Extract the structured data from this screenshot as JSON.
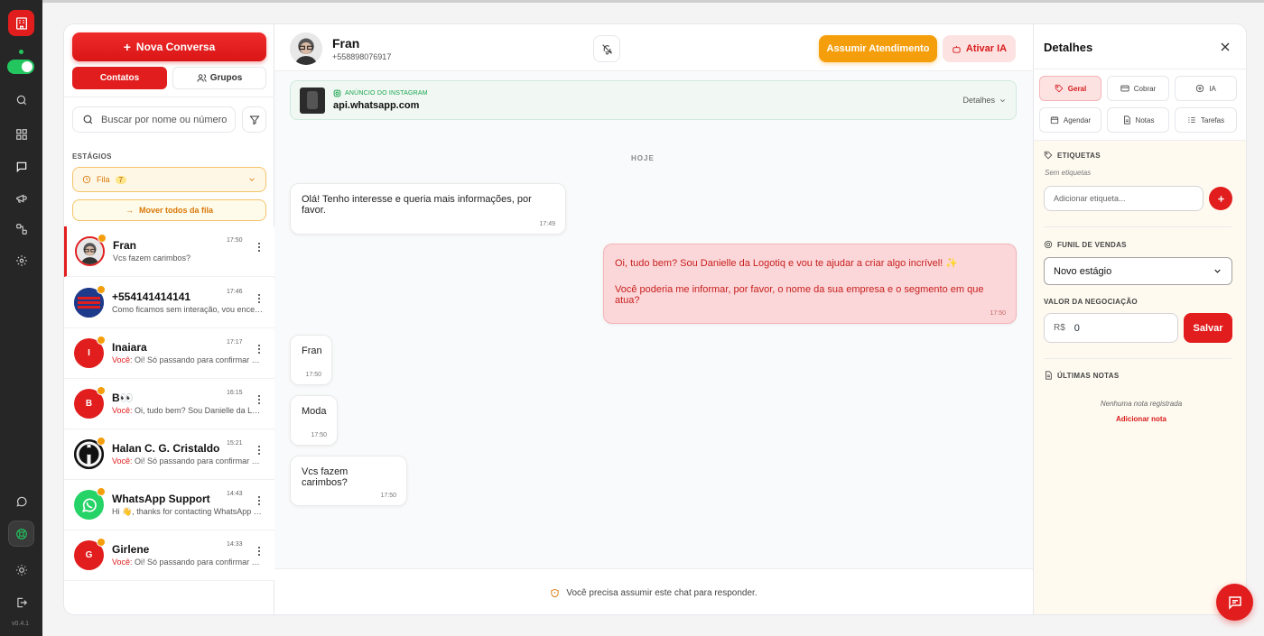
{
  "app": {
    "version": "v0.4.1"
  },
  "sidebar_left": {
    "icons": [
      "building-icon",
      "home-icon",
      "search-icon",
      "dashboard-icon",
      "chat-icon",
      "megaphone-icon",
      "flow-icon",
      "settings-icon",
      "whatsapp-icon",
      "support-icon",
      "sun-icon",
      "logout-icon"
    ]
  },
  "conversations": {
    "new_button": "Nova Conversa",
    "tabs": {
      "contacts": "Contatos",
      "groups": "Grupos"
    },
    "search_placeholder": "Buscar por nome ou número",
    "stages_label": "ESTÁGIOS",
    "stage_selected": "Fila",
    "stage_count": "7",
    "move_all": "Mover todos da fila",
    "you_prefix": "Você:",
    "items": [
      {
        "name": "Fran",
        "time": "17:50",
        "preview": "Vcs fazem carimbos?",
        "you": false,
        "initial": ""
      },
      {
        "name": "+554141414141",
        "time": "17:46",
        "preview": "Como ficamos sem interação, vou encerrar",
        "you": false,
        "initial": ""
      },
      {
        "name": "Inaiara",
        "time": "17:17",
        "preview": "Oi! Só passando para confirmar se ainda",
        "you": true,
        "initial": "I"
      },
      {
        "name": "B👀",
        "time": "16:15",
        "preview": "Oi, tudo bem? Sou Danielle da Logotiq",
        "you": true,
        "initial": "B"
      },
      {
        "name": "Halan C. G. Cristaldo",
        "time": "15:21",
        "preview": "Oi! Só passando para confirmar se ainda",
        "you": true,
        "initial": ""
      },
      {
        "name": "WhatsApp Support",
        "time": "14:43",
        "preview": "Hi 👋, thanks for contacting WhatsApp Support",
        "you": false,
        "initial": ""
      },
      {
        "name": "Girlene",
        "time": "14:33",
        "preview": "Oi! Só passando para confirmar se ainda",
        "you": true,
        "initial": "G"
      }
    ]
  },
  "chat": {
    "contact_name": "Fran",
    "contact_phone": "+558898076917",
    "assume_button": "Assumir Atendimento",
    "ai_button": "Ativar IA",
    "ad": {
      "tag": "ANÚNCIO DO INSTAGRAM",
      "url": "api.whatsapp.com",
      "details": "Detalhes"
    },
    "day_label": "HOJE",
    "messages": [
      {
        "text": "Olá! Tenho interesse e queria mais informações, por favor.",
        "time": "17:49",
        "dir": "in"
      },
      {
        "text": "Oi, tudo bem? Sou Danielle da Logotiq e vou te ajudar a criar algo incrível! ✨",
        "text2": "Você poderia me informar, por favor, o nome da sua empresa e o segmento em que atua?",
        "time": "17:50",
        "dir": "out"
      },
      {
        "text": "Fran",
        "time": "17:50",
        "dir": "in"
      },
      {
        "text": "Moda",
        "time": "17:50",
        "dir": "in"
      },
      {
        "text": "Vcs fazem carimbos?",
        "time": "17:50",
        "dir": "in"
      }
    ],
    "footer_notice": "Você precisa assumir este chat para responder."
  },
  "details": {
    "title": "Detalhes",
    "tabs": [
      "Geral",
      "Cobrar",
      "IA",
      "Agendar",
      "Notas",
      "Tarefas"
    ],
    "active_tab": "Geral",
    "tags_label": "ETIQUETAS",
    "no_tags": "Sem etiquetas",
    "tag_placeholder": "Adicionar etiqueta...",
    "funnel_label": "FUNIL DE VENDAS",
    "funnel_value": "Novo estágio",
    "deal_label": "VALOR DA NEGOCIAÇÃO",
    "currency": "R$",
    "deal_value": "0",
    "save_button": "Salvar",
    "notes_label": "ÚLTIMAS NOTAS",
    "no_notes": "Nenhuma nota registrada",
    "add_note": "Adicionar nota"
  },
  "colors": {
    "accent": "#e11d1d",
    "warning": "#f59e0b",
    "success": "#22c55e"
  }
}
